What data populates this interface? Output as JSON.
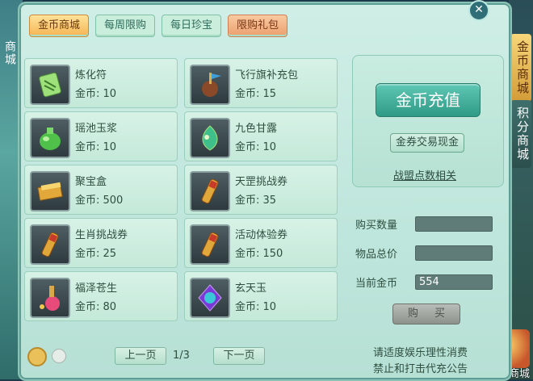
{
  "left_side": {
    "text": "商城"
  },
  "tabs": [
    {
      "label": "金币商城",
      "active": true
    },
    {
      "label": "每周限购"
    },
    {
      "label": "每日珍宝"
    },
    {
      "label": "限购礼包"
    }
  ],
  "items": [
    {
      "name": "炼化符",
      "price": "金币: 10",
      "icon": "talisman-icon"
    },
    {
      "name": "飞行旗补充包",
      "price": "金币: 15",
      "icon": "flag-pack-icon"
    },
    {
      "name": "瑶池玉浆",
      "price": "金币: 10",
      "icon": "jade-potion-icon"
    },
    {
      "name": "九色甘露",
      "price": "金币: 10",
      "icon": "dew-icon"
    },
    {
      "name": "聚宝盒",
      "price": "金币: 500",
      "icon": "treasure-box-icon"
    },
    {
      "name": "天罡挑战券",
      "price": "金币: 35",
      "icon": "scroll-icon"
    },
    {
      "name": "生肖挑战券",
      "price": "金币: 25",
      "icon": "scroll-icon"
    },
    {
      "name": "活动体验券",
      "price": "金币: 150",
      "icon": "scroll-icon"
    },
    {
      "name": "福泽苍生",
      "price": "金币: 80",
      "icon": "gift-icon"
    },
    {
      "name": "玄天玉",
      "price": "金币: 10",
      "icon": "gem-icon"
    }
  ],
  "recharge": {
    "button": "金币充值",
    "trade": "金券交易现金",
    "alliance_link": "战盟点数相关"
  },
  "purchase": {
    "qty_label": "购买数量",
    "qty_value": "",
    "total_label": "物品总价",
    "total_value": "",
    "gold_label": "当前金币",
    "gold_value": "554",
    "buy_button": "购 买"
  },
  "pager": {
    "prev": "上一页",
    "indicator": "1/3",
    "next": "下一页"
  },
  "notice": {
    "line1": "请适度娱乐理性消费",
    "line2": "禁止和打击代充公告"
  },
  "side_tabs": {
    "gold_shop": "金币商城",
    "points_shop": "积分商城",
    "appearance_shop": "外观商城"
  },
  "colors": {
    "panel_bg": "#bfe6dc",
    "active_tab": "#f4b452",
    "recharge_button": "#2f9a86",
    "field_bg": "#5f7c78"
  }
}
